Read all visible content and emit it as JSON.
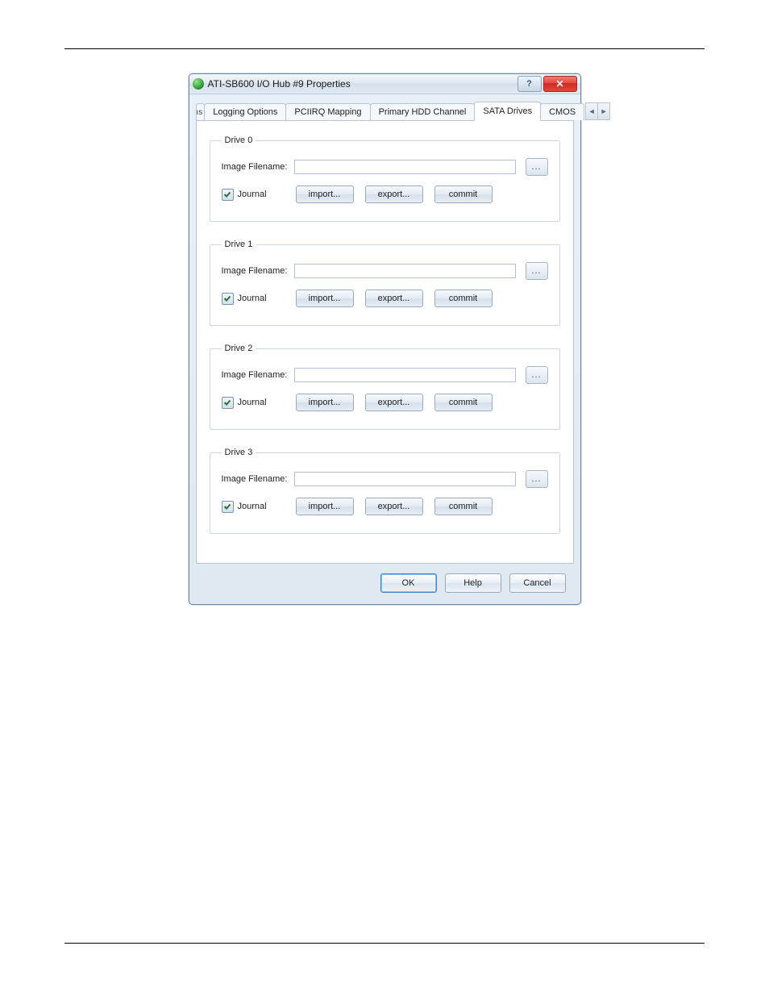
{
  "window": {
    "title": "ATI-SB600 I/O Hub #9 Properties",
    "help_symbol": "?",
    "close_symbol": "✕"
  },
  "tabs": {
    "partial_left": "ıs",
    "items": [
      {
        "label": "Logging Options"
      },
      {
        "label": "PCIIRQ Mapping"
      },
      {
        "label": "Primary HDD Channel"
      },
      {
        "label": "SATA Drives"
      },
      {
        "label": "CMOS"
      }
    ],
    "selected_index": 3,
    "scroll_left": "◄",
    "scroll_right": "►"
  },
  "drives": [
    {
      "legend": "Drive 0",
      "filename_label": "Image Filename:",
      "filename_value": "",
      "browse": "...",
      "journal_checked": true,
      "journal_label": "Journal",
      "import": "import...",
      "export": "export...",
      "commit": "commit"
    },
    {
      "legend": "Drive 1",
      "filename_label": "Image Filename:",
      "filename_value": "",
      "browse": "...",
      "journal_checked": true,
      "journal_label": "Journal",
      "import": "import...",
      "export": "export...",
      "commit": "commit"
    },
    {
      "legend": "Drive 2",
      "filename_label": "Image Filename:",
      "filename_value": "",
      "browse": "...",
      "journal_checked": true,
      "journal_label": "Journal",
      "import": "import...",
      "export": "export...",
      "commit": "commit"
    },
    {
      "legend": "Drive 3",
      "filename_label": "Image Filename:",
      "filename_value": "",
      "browse": "...",
      "journal_checked": true,
      "journal_label": "Journal",
      "import": "import...",
      "export": "export...",
      "commit": "commit"
    }
  ],
  "buttons": {
    "ok": "OK",
    "help": "Help",
    "cancel": "Cancel"
  }
}
